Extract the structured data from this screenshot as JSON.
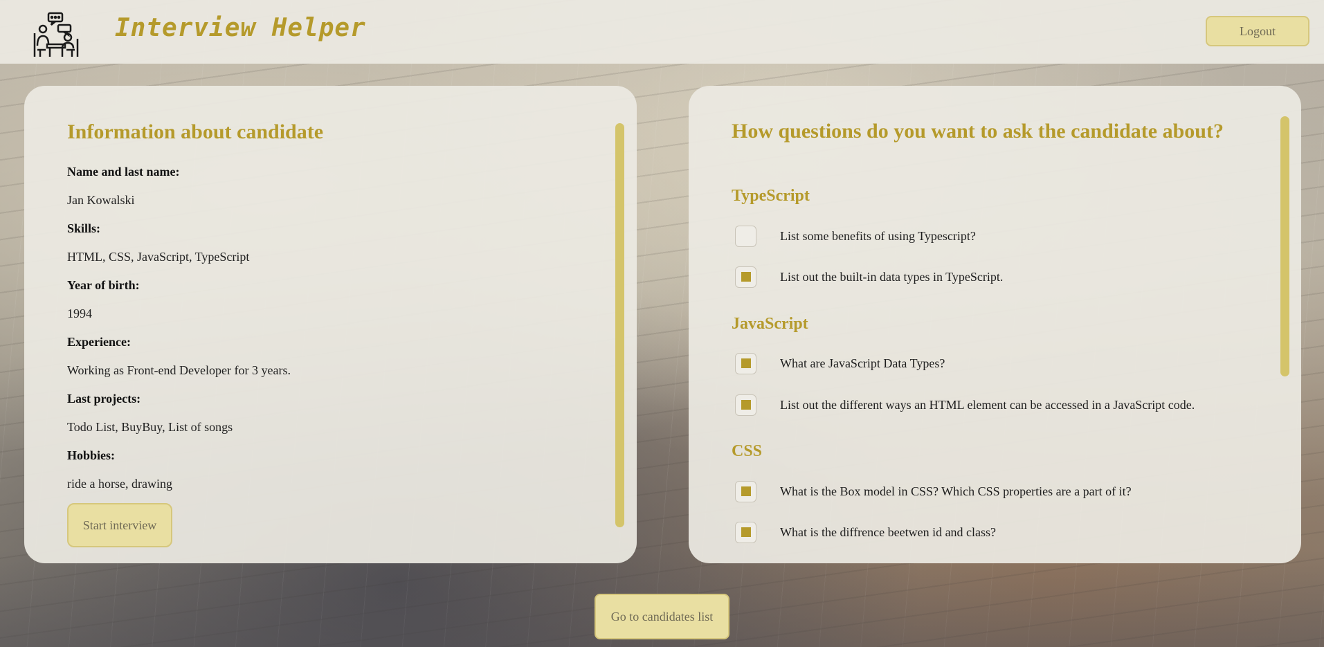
{
  "header": {
    "app_title": "Interview Helper",
    "logout_label": "Logout",
    "logo_icon": "interview-people-icon"
  },
  "candidate": {
    "title": "Information about candidate",
    "fields": [
      {
        "label": "Name and last name:",
        "value": "Jan Kowalski"
      },
      {
        "label": "Skills:",
        "value": "HTML, CSS, JavaScript, TypeScript"
      },
      {
        "label": "Year of birth:",
        "value": "1994"
      },
      {
        "label": "Experience:",
        "value": "Working as Front-end Developer for 3 years."
      },
      {
        "label": "Last projects:",
        "value": "Todo List, BuyBuy, List of songs"
      },
      {
        "label": "Hobbies:",
        "value": "ride a horse, drawing"
      }
    ],
    "start_label": "Start interview"
  },
  "questions": {
    "title": "How questions do you want to ask the candidate about?",
    "sections": [
      {
        "name": "TypeScript",
        "items": [
          {
            "text": "List some benefits of using Typescript?",
            "checked": false
          },
          {
            "text": "List out the built-in data types in TypeScript.",
            "checked": true
          }
        ]
      },
      {
        "name": "JavaScript",
        "items": [
          {
            "text": "What are JavaScript Data Types?",
            "checked": true
          },
          {
            "text": "List out the different ways an HTML element can be accessed in a JavaScript code.",
            "checked": true
          }
        ]
      },
      {
        "name": "CSS",
        "items": [
          {
            "text": "What is the Box model in CSS? Which CSS properties are a part of it?",
            "checked": true
          },
          {
            "text": "What is the diffrence beetwen id and class?",
            "checked": true
          }
        ]
      }
    ]
  },
  "footer": {
    "candidates_list_label": "Go to candidates list"
  },
  "colors": {
    "accent": "#b59a2b",
    "button_bg": "#e9dfa2"
  }
}
